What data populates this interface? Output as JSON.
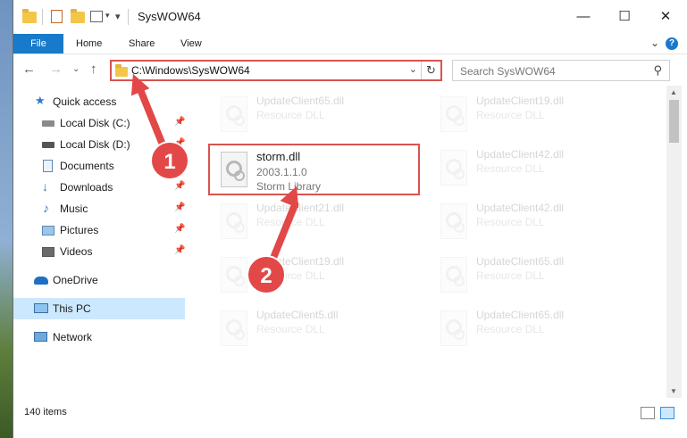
{
  "window": {
    "title": "SysWOW64",
    "controls": {
      "minimize": "—",
      "maximize": "☐",
      "close": "✕"
    }
  },
  "ribbon": {
    "tabs": [
      {
        "label": "File",
        "active": true
      },
      {
        "label": "Home"
      },
      {
        "label": "Share"
      },
      {
        "label": "View"
      }
    ],
    "expand_glyph": "⌄",
    "help_glyph": "?"
  },
  "nav": {
    "back": "←",
    "forward": "→",
    "recent": "⌄",
    "up": "↑",
    "address": "C:\\Windows\\SysWOW64",
    "address_dropdown": "⌄",
    "refresh": "↻",
    "search_placeholder": "Search SysWOW64",
    "search_glyph": "⚲"
  },
  "sidebar": {
    "items": [
      {
        "label": "Quick access",
        "icon": "star-icon",
        "pinned": false
      },
      {
        "label": "Local Disk (C:)",
        "icon": "drive-icon",
        "pinned": true
      },
      {
        "label": "Local Disk (D:)",
        "icon": "drive-icon",
        "pinned": true
      },
      {
        "label": "Documents",
        "icon": "documents-icon",
        "pinned": true
      },
      {
        "label": "Downloads",
        "icon": "download-icon",
        "pinned": true
      },
      {
        "label": "Music",
        "icon": "music-icon",
        "pinned": true
      },
      {
        "label": "Pictures",
        "icon": "pictures-icon",
        "pinned": true
      },
      {
        "label": "Videos",
        "icon": "videos-icon",
        "pinned": true
      },
      {
        "label": "OneDrive",
        "icon": "cloud-icon",
        "pinned": false
      },
      {
        "label": "This PC",
        "icon": "computer-icon",
        "pinned": false,
        "selected": true
      },
      {
        "label": "Network",
        "icon": "network-icon",
        "pinned": false
      }
    ],
    "pin_glyph": "📌"
  },
  "files": {
    "left_column": [
      {
        "name": "UpdateClient65.dll",
        "meta": "Resource DLL",
        "faded": true
      },
      {
        "name": "storm.dll",
        "version": "2003.1.1.0",
        "meta": "Storm Library",
        "faded": false
      },
      {
        "name": "UpdateClient21.dll",
        "meta": "Resource DLL",
        "faded": true
      },
      {
        "name": "UpdateClient19.dll",
        "meta": "Resource DLL",
        "faded": true
      },
      {
        "name": "UpdateClient5.dll",
        "meta": "Resource DLL",
        "faded": true
      }
    ],
    "right_column": [
      {
        "name": "UpdateClient19.dll",
        "meta": "Resource DLL",
        "faded": true
      },
      {
        "name": "UpdateClient42.dll",
        "meta": "Resource DLL",
        "faded": true
      },
      {
        "name": "UpdateClient42.dll",
        "meta": "Resource DLL",
        "faded": true
      },
      {
        "name": "UpdateClient65.dll",
        "meta": "Resource DLL",
        "faded": true
      },
      {
        "name": "UpdateClient65.dll",
        "meta": "Resource DLL",
        "faded": true
      }
    ]
  },
  "status": {
    "item_count": "140 items"
  },
  "annotations": {
    "step1": "1",
    "step2": "2",
    "color": "#e24848"
  }
}
